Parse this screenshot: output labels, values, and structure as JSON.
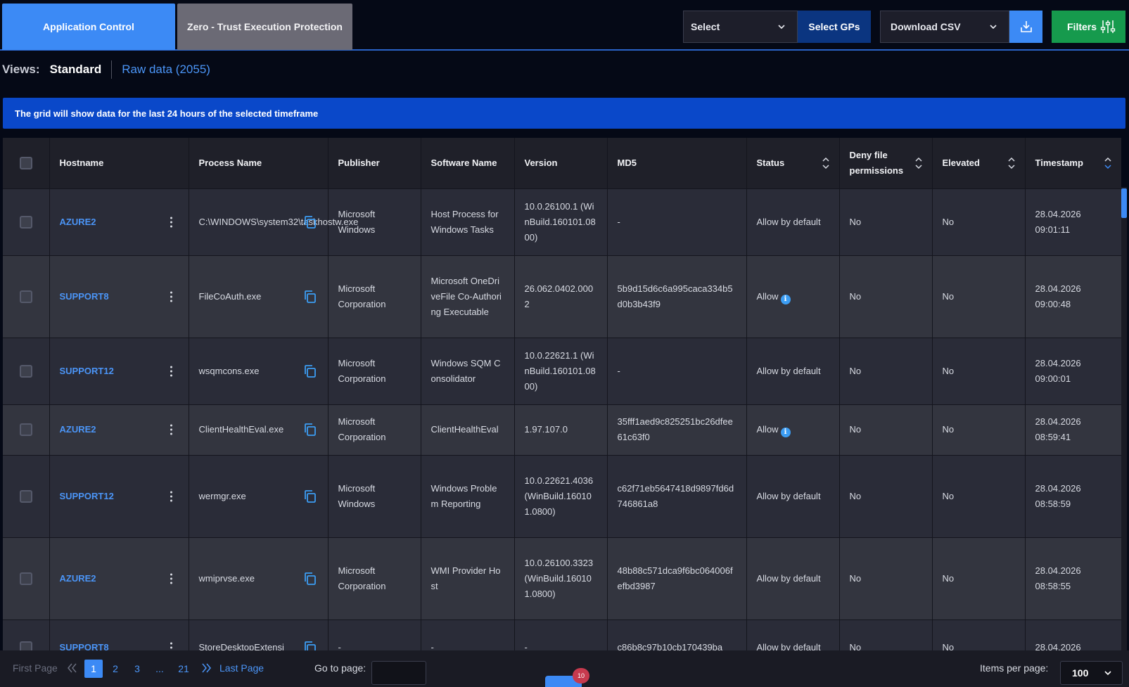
{
  "tabs": [
    {
      "label": "Application Control"
    },
    {
      "label": "Zero - Trust Execution Protection"
    }
  ],
  "toolbar": {
    "select_label": "Select",
    "select_gps_label": "Select GPs",
    "download_csv_label": "Download CSV",
    "filters_label": "Filters"
  },
  "views": {
    "label": "Views:",
    "standard": "Standard",
    "raw": "Raw data (2055)"
  },
  "banner": "The grid will show data for the last 24 hours of the selected timeframe",
  "columns": [
    "Hostname",
    "Process Name",
    "Publisher",
    "Software Name",
    "Version",
    "MD5",
    "Status",
    "Deny file permissions",
    "Elevated",
    "Timestamp"
  ],
  "rows": [
    {
      "hostname": "AZURE2",
      "process": "C:\\WINDOWS\\system32\\taskhostw.exe",
      "publisher": "Microsoft Windows",
      "software": "Host Process for Windows Tasks",
      "version": "10.0.26100.1 (WinBuild.160101.0800)",
      "md5": "-",
      "status": "Allow by default",
      "status_info": "",
      "deny": "No",
      "elevated": "No",
      "timestamp": "28.04.2026 09:01:11"
    },
    {
      "hostname": "SUPPORT8",
      "process": "FileCoAuth.exe",
      "publisher": "Microsoft Corporation",
      "software": "Microsoft OneDriveFile Co-Authoring Executable",
      "version": "26.062.0402.0002",
      "md5": "5b9d15d6c6a995caca334b5d0b3b43f9",
      "status": "Allow",
      "status_info": "i",
      "deny": "No",
      "elevated": "No",
      "timestamp": "28.04.2026 09:00:48"
    },
    {
      "hostname": "SUPPORT12",
      "process": "wsqmcons.exe",
      "publisher": "Microsoft Corporation",
      "software": "Windows SQM Consolidator",
      "version": "10.0.22621.1 (WinBuild.160101.0800)",
      "md5": "-",
      "status": "Allow by default",
      "status_info": "",
      "deny": "No",
      "elevated": "No",
      "timestamp": "28.04.2026 09:00:01"
    },
    {
      "hostname": "AZURE2",
      "process": "ClientHealthEval.exe",
      "publisher": "Microsoft Corporation",
      "software": "ClientHealthEval",
      "version": "1.97.107.0",
      "md5": "35fff1aed9c825251bc26dfee61c63f0",
      "status": "Allow",
      "status_info": "i",
      "deny": "No",
      "elevated": "No",
      "timestamp": "28.04.2026 08:59:41"
    },
    {
      "hostname": "SUPPORT12",
      "process": "wermgr.exe",
      "publisher": "Microsoft Windows",
      "software": "Windows Problem Reporting",
      "version": "10.0.22621.4036 (WinBuild.160101.0800)",
      "md5": "c62f71eb5647418d9897fd6d746861a8",
      "status": "Allow by default",
      "status_info": "",
      "deny": "No",
      "elevated": "No",
      "timestamp": "28.04.2026 08:58:59"
    },
    {
      "hostname": "AZURE2",
      "process": "wmiprvse.exe",
      "publisher": "Microsoft Corporation",
      "software": "WMI Provider Host",
      "version": "10.0.26100.3323 (WinBuild.160101.0800)",
      "md5": "48b88c571dca9f6bc064006fefbd3987",
      "status": "Allow by default",
      "status_info": "",
      "deny": "No",
      "elevated": "No",
      "timestamp": "28.04.2026 08:58:55"
    },
    {
      "hostname": "SUPPORT8",
      "process": "StoreDesktopExtensi",
      "publisher": "-",
      "software": "-",
      "version": "-",
      "md5": "c86b8c97b10cb170439ba",
      "status": "Allow by default",
      "status_info": "",
      "deny": "No",
      "elevated": "No",
      "timestamp": "28.04.2026"
    }
  ],
  "pager": {
    "first": "First Page",
    "pages": [
      "1",
      "2",
      "3",
      "...",
      "21"
    ],
    "last": "Last Page",
    "goto_label": "Go to page:",
    "items_label": "Items per page:",
    "items_value": "100",
    "notification_count": "10"
  },
  "colors": {
    "accent": "#3c8af5",
    "banner": "#0a48c9",
    "filters": "#169a4d",
    "link": "#4b95f7"
  }
}
